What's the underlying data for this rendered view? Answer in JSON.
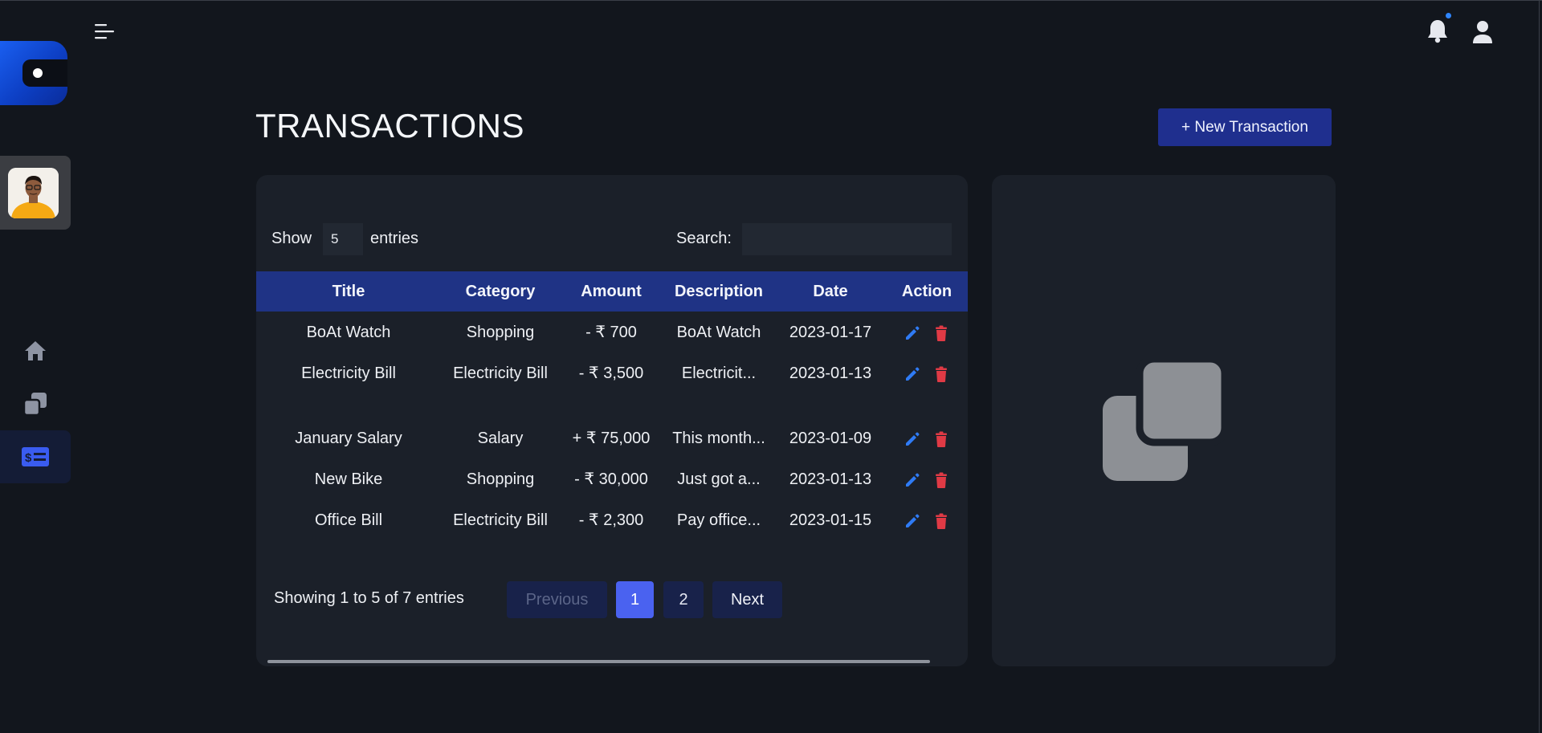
{
  "header": {
    "title": "TRANSACTIONS",
    "new_button": "+ New Transaction"
  },
  "sidebar": {
    "items": [
      {
        "icon": "home-icon"
      },
      {
        "icon": "copy-icon"
      },
      {
        "icon": "money-icon",
        "active": true
      }
    ]
  },
  "table": {
    "show_label": "Show",
    "entries_value": "5",
    "entries_label": "entries",
    "search_label": "Search:",
    "search_value": "",
    "columns": [
      "Title",
      "Category",
      "Amount",
      "Description",
      "Date",
      "Action"
    ],
    "rows": [
      {
        "title": "BoAt Watch",
        "category": "Shopping",
        "amount": "- ₹ 700",
        "description": "BoAt Watch",
        "date": "2023-01-17"
      },
      {
        "title": "Electricity Bill",
        "category": "Electricity Bill",
        "amount": "- ₹ 3,500",
        "description": "Electricit...",
        "date": "2023-01-13"
      },
      {
        "title": "January Salary",
        "category": "Salary",
        "amount": "+ ₹ 75,000",
        "description": "This month...",
        "date": "2023-01-09"
      },
      {
        "title": "New Bike",
        "category": "Shopping",
        "amount": "- ₹ 30,000",
        "description": "Just got a...",
        "date": "2023-01-13"
      },
      {
        "title": "Office Bill",
        "category": "Electricity Bill",
        "amount": "- ₹ 2,300",
        "description": "Pay office...",
        "date": "2023-01-15"
      }
    ],
    "info": "Showing 1 to 5 of 7 entries",
    "pagination": {
      "previous": "Previous",
      "pages": [
        "1",
        "2"
      ],
      "next": "Next"
    }
  },
  "colors": {
    "background": "#12161d",
    "card": "#1b2029",
    "header_row": "#1f3385",
    "primary_button": "#1f2f8e",
    "active_page": "#4a62f0",
    "edit_icon": "#2f7bf5",
    "delete_icon": "#e03a45",
    "notification_dot": "#2f86ff"
  }
}
